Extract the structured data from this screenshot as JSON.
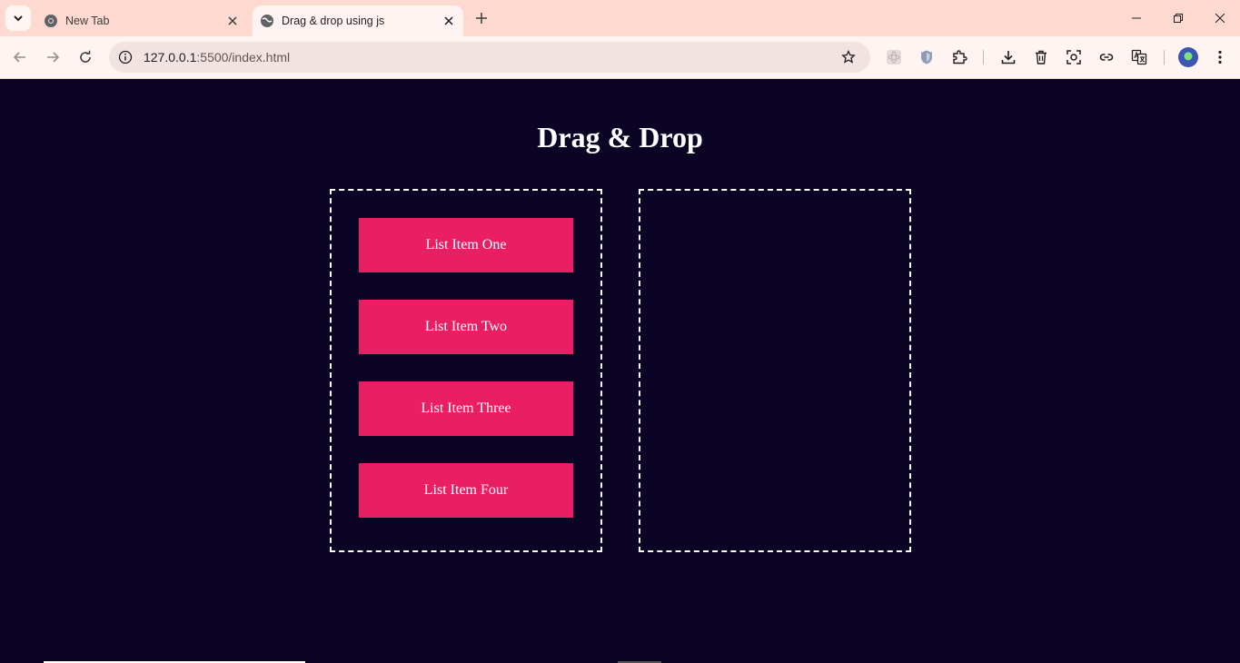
{
  "browser": {
    "tabs": [
      {
        "title": "New Tab",
        "favicon": "chrome-icon",
        "active": false
      },
      {
        "title": "Drag & drop using js",
        "favicon": "globe-icon",
        "active": true
      }
    ],
    "url_host": "127.0.0.1",
    "url_rest": ":5500/index.html",
    "colors": {
      "tabstrip": "#fdd9d0",
      "toolbar": "#fff4f1",
      "omnibox": "#f1e3e1"
    }
  },
  "page": {
    "title": "Drag & Drop",
    "colors": {
      "background": "#0b0424",
      "item": "#e91e63",
      "border": "#ffffff"
    },
    "left_box": {
      "items": [
        "List Item One",
        "List Item Two",
        "List Item Three",
        "List Item Four"
      ]
    },
    "right_box": {
      "items": []
    }
  }
}
